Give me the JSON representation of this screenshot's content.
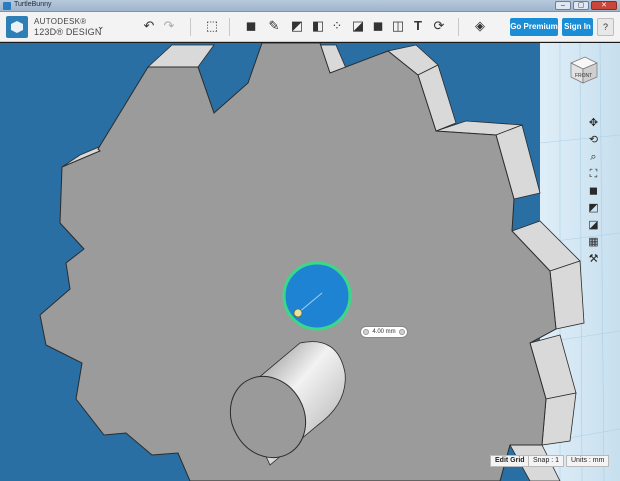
{
  "window": {
    "title": "TurtleBunny"
  },
  "app": {
    "brand_line1": "AUTODESK®",
    "brand_line2": "123D® DESIGN"
  },
  "toolbar": {
    "undo_icon": "undo-arrow-icon",
    "redo_icon": "redo-arrow-icon",
    "tools": [
      "transform",
      "primitives",
      "sketch",
      "construct",
      "modify",
      "pattern",
      "grouping",
      "combine",
      "measure",
      "text",
      "snap",
      "material"
    ],
    "premium_label": "Go Premium",
    "signin_label": "Sign In",
    "help_label": "?"
  },
  "viewcube": {
    "face_label": "FRONT"
  },
  "viewport": {
    "dimension_value": "4.00 mm",
    "colors": {
      "background": "#2a6fa3",
      "gear_face": "#9a9a9a",
      "selection": "#3ad98a",
      "hole_fill": "#1f83d4"
    }
  },
  "statusbar": {
    "edit_grid_label": "Edit Grid",
    "snap_label": "Snap : 1",
    "units_label": "Units : mm"
  }
}
